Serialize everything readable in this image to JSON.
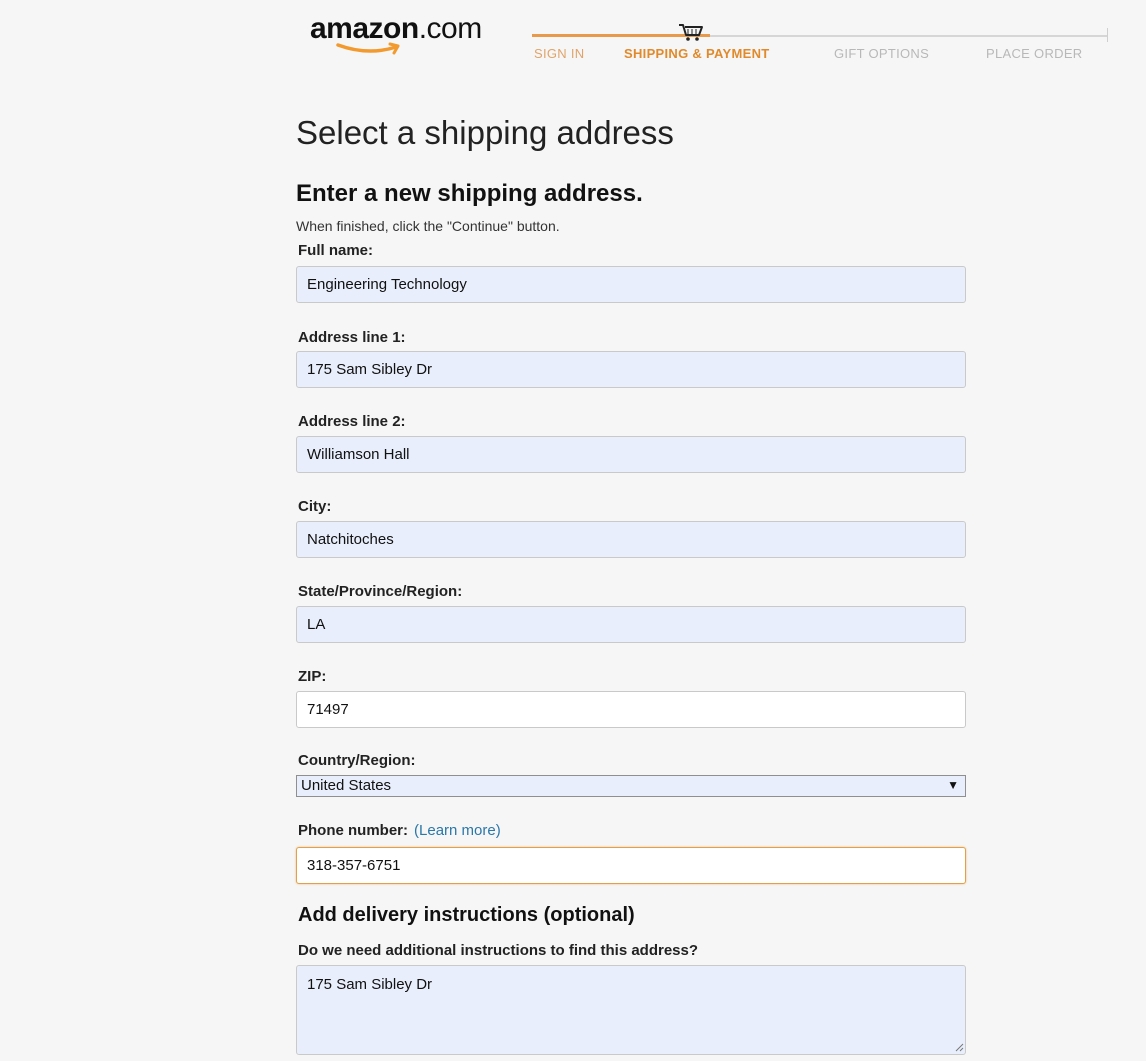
{
  "header": {
    "logo_bold": "amazon",
    "logo_suffix": ".com",
    "steps": [
      {
        "label": "SIGN IN",
        "state": "done"
      },
      {
        "label": "SHIPPING & PAYMENT",
        "state": "active"
      },
      {
        "label": "GIFT OPTIONS",
        "state": "todo"
      },
      {
        "label": "PLACE ORDER",
        "state": "todo"
      }
    ],
    "cart_icon": "shopping-cart-icon"
  },
  "page": {
    "title": "Select a shipping address",
    "subtitle": "Enter a new shipping address.",
    "instruction": "When finished, click the \"Continue\" button."
  },
  "form": {
    "full_name": {
      "label": "Full name:",
      "value": "Engineering Technology"
    },
    "address1": {
      "label": "Address line 1:",
      "value": "175 Sam Sibley Dr"
    },
    "address2": {
      "label": "Address line 2:",
      "value": "Williamson Hall"
    },
    "city": {
      "label": "City:",
      "value": "Natchitoches"
    },
    "state": {
      "label": "State/Province/Region:",
      "value": "LA"
    },
    "zip": {
      "label": "ZIP:",
      "value": "71497"
    },
    "country": {
      "label": "Country/Region:",
      "selected": "United States"
    },
    "phone": {
      "label": "Phone number:",
      "learn_more": "(Learn more)",
      "value": "318-357-6751"
    }
  },
  "delivery": {
    "heading": "Add delivery instructions (optional)",
    "question": "Do we need additional instructions to find this address?",
    "value": "175 Sam Sibley Dr"
  },
  "colors": {
    "accent_orange": "#e08a2c",
    "autofill_blue": "#e8eefc",
    "link_blue": "#2a77a8"
  }
}
